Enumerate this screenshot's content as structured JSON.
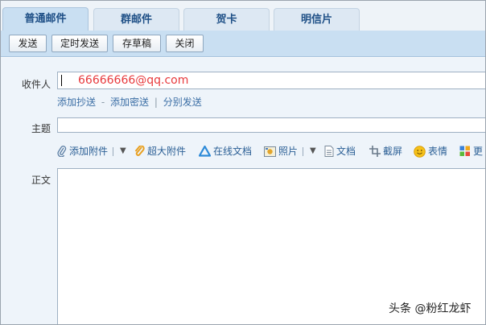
{
  "tabs": [
    {
      "label": "普通邮件",
      "active": true
    },
    {
      "label": "群邮件",
      "active": false
    },
    {
      "label": "贺卡",
      "active": false
    },
    {
      "label": "明信片",
      "active": false
    }
  ],
  "toolbar": {
    "send_label": "发送",
    "timed_send_label": "定时发送",
    "draft_label": "存草稿",
    "close_label": "关闭"
  },
  "compose": {
    "to_label": "收件人",
    "to_value": "66666666@qq.com",
    "cc_link": "添加抄送",
    "cc_sep": "-",
    "bcc_link": "添加密送",
    "split_sep": "|",
    "split_link": "分别发送",
    "subject_label": "主题",
    "subject_value": "",
    "body_label": "正文",
    "body_value": ""
  },
  "attach_bar": {
    "add_attachment": "添加附件",
    "huge_attachment": "超大附件",
    "online_doc": "在线文档",
    "photo": "照片",
    "document": "文档",
    "screenshot": "截屏",
    "emoji": "表情",
    "more": "更"
  },
  "watermark": "头条 @粉红龙虾",
  "colors": {
    "tab_text": "#1e4f86",
    "toolbar_bg": "#c9dff2",
    "form_bg": "#eef4fa",
    "recipient_text": "#e8393c",
    "link": "#3b6ea5"
  }
}
